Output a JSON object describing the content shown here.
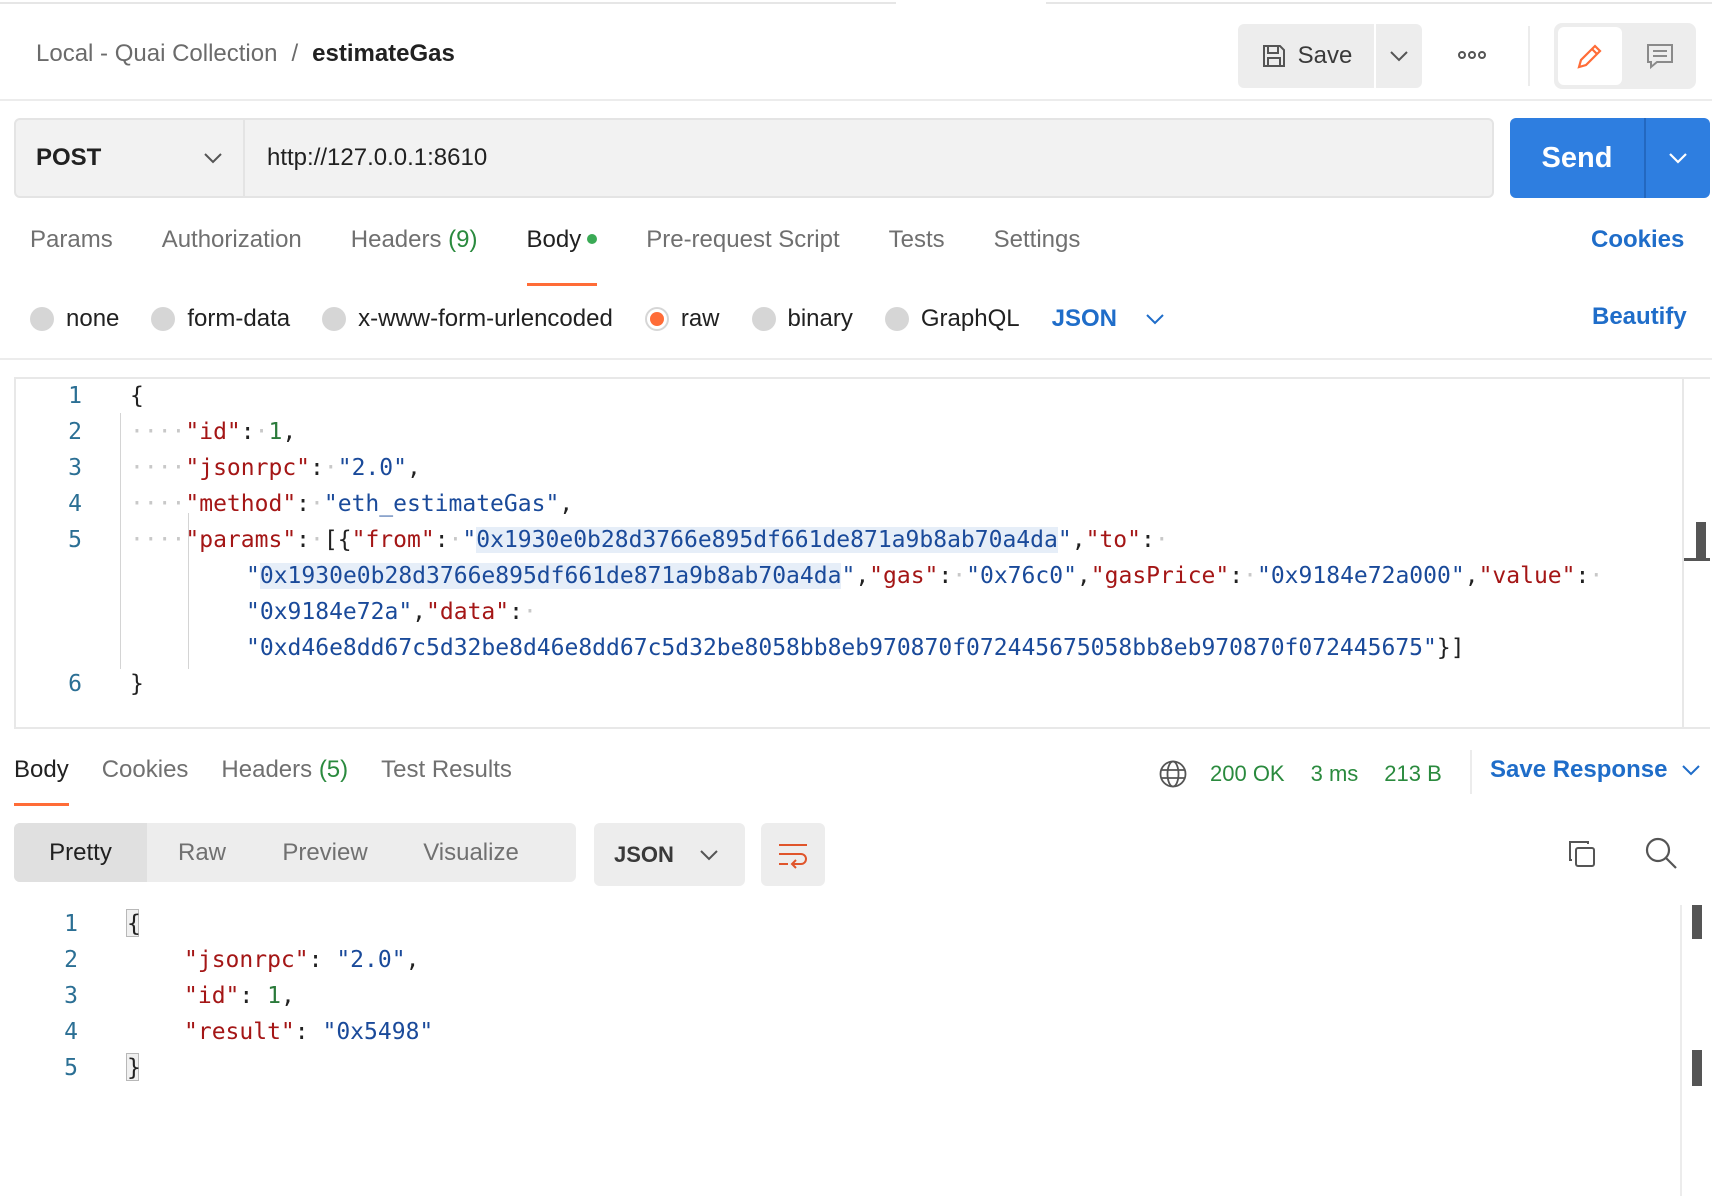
{
  "header": {
    "breadcrumb_parent": "Local - Quai Collection",
    "breadcrumb_sep": "/",
    "breadcrumb_current": "estimateGas",
    "save_label": "Save"
  },
  "request": {
    "method": "POST",
    "url": "http://127.0.0.1:8610",
    "send_label": "Send"
  },
  "request_tabs": [
    {
      "label": "Params",
      "count": ""
    },
    {
      "label": "Authorization",
      "count": ""
    },
    {
      "label": "Headers",
      "count": "(9)"
    },
    {
      "label": "Body",
      "count": "",
      "active": true
    },
    {
      "label": "Pre-request Script",
      "count": ""
    },
    {
      "label": "Tests",
      "count": ""
    },
    {
      "label": "Settings",
      "count": ""
    }
  ],
  "cookies_label": "Cookies",
  "body_types": [
    {
      "label": "none",
      "selected": false
    },
    {
      "label": "form-data",
      "selected": false
    },
    {
      "label": "x-www-form-urlencoded",
      "selected": false
    },
    {
      "label": "raw",
      "selected": true
    },
    {
      "label": "binary",
      "selected": false
    },
    {
      "label": "GraphQL",
      "selected": false
    }
  ],
  "body_format": "JSON",
  "beautify_label": "Beautify",
  "editor": {
    "line_numbers": [
      "1",
      "2",
      "3",
      "4",
      "5",
      "6"
    ],
    "open_brace": "{",
    "close_brace": "}",
    "id_key": "\"id\"",
    "id_val": "1",
    "jsonrpc_key": "\"jsonrpc\"",
    "jsonrpc_val": "\"2.0\"",
    "method_key": "\"method\"",
    "method_val": "\"eth_estimateGas\"",
    "params_key": "\"params\"",
    "from_key": "\"from\"",
    "from_val": "0x1930e0b28d3766e895df661de871a9b8ab70a4da",
    "to_key": "\"to\"",
    "to_val": "0x1930e0b28d3766e895df661de871a9b8ab70a4da",
    "gas_key": "\"gas\"",
    "gas_val": "\"0x76c0\"",
    "gasprice_key": "\"gasPrice\"",
    "gasprice_val": "\"0x9184e72a000\"",
    "value_key": "\"value\"",
    "value_val": "\"0x9184e72a\"",
    "data_key": "\"data\"",
    "data_val": "\"0xd46e8dd67c5d32be8d46e8dd67c5d32be8058bb8eb970870f072445675058bb8eb970870f072445675\""
  },
  "response_tabs": [
    {
      "label": "Body",
      "count": "",
      "active": true
    },
    {
      "label": "Cookies",
      "count": ""
    },
    {
      "label": "Headers",
      "count": "(5)"
    },
    {
      "label": "Test Results",
      "count": ""
    }
  ],
  "response_status": {
    "code": "200 OK",
    "time": "3 ms",
    "size": "213 B"
  },
  "save_response_label": "Save Response",
  "view_modes": [
    "Pretty",
    "Raw",
    "Preview",
    "Visualize"
  ],
  "response_format": "JSON",
  "response_body": {
    "line_numbers": [
      "1",
      "2",
      "3",
      "4",
      "5"
    ],
    "open_brace": "{",
    "close_brace": "}",
    "jsonrpc_key": "\"jsonrpc\"",
    "jsonrpc_val": "\"2.0\"",
    "id_key": "\"id\"",
    "id_val": "1",
    "result_key": "\"result\"",
    "result_val": "\"0x5498\""
  },
  "colors": {
    "accent_orange": "#ff6c37",
    "send_blue": "#2e7ee0",
    "link_blue": "#1f6dc9",
    "status_green": "#2a8a3e"
  }
}
